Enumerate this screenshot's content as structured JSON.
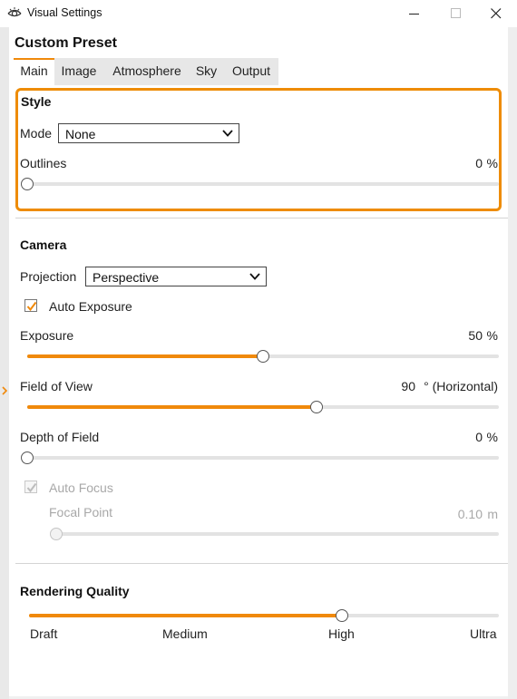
{
  "window": {
    "title": "Visual Settings",
    "icon": "eye-icon",
    "controls": [
      "minimize-icon",
      "maximize-icon",
      "close-icon"
    ]
  },
  "preset": {
    "title": "Custom Preset"
  },
  "tabs": [
    {
      "label": "Main",
      "active": true
    },
    {
      "label": "Image",
      "active": false
    },
    {
      "label": "Atmosphere",
      "active": false
    },
    {
      "label": "Sky",
      "active": false
    },
    {
      "label": "Output",
      "active": false
    }
  ],
  "style": {
    "title": "Style",
    "mode": {
      "label": "Mode",
      "value": "None"
    },
    "outlines": {
      "label": "Outlines",
      "value": "0",
      "unit": "%",
      "fraction": 0
    }
  },
  "camera": {
    "title": "Camera",
    "projection": {
      "label": "Projection",
      "value": "Perspective"
    },
    "auto_exposure": {
      "label": "Auto Exposure",
      "checked": true
    },
    "exposure": {
      "label": "Exposure",
      "value": "50",
      "unit": "%",
      "fraction": 0.5
    },
    "field_of_view": {
      "label": "Field of View",
      "value": "90",
      "unit": "° (Horizontal)",
      "fraction": 0.614
    },
    "depth_of_field": {
      "label": "Depth of Field",
      "value": "0",
      "unit": "%",
      "fraction": 0
    },
    "auto_focus": {
      "label": "Auto Focus",
      "checked": true,
      "disabled": true
    },
    "focal_point": {
      "label": "Focal Point",
      "value": "0.10",
      "unit": "m",
      "fraction": 0,
      "disabled": true
    }
  },
  "rendering_quality": {
    "title": "Rendering Quality",
    "levels": [
      "Draft",
      "Medium",
      "High",
      "Ultra"
    ],
    "selected": "High",
    "fraction": 0.6667
  },
  "colors": {
    "accent": "#f0890b",
    "highlight": "#ee8c06"
  }
}
